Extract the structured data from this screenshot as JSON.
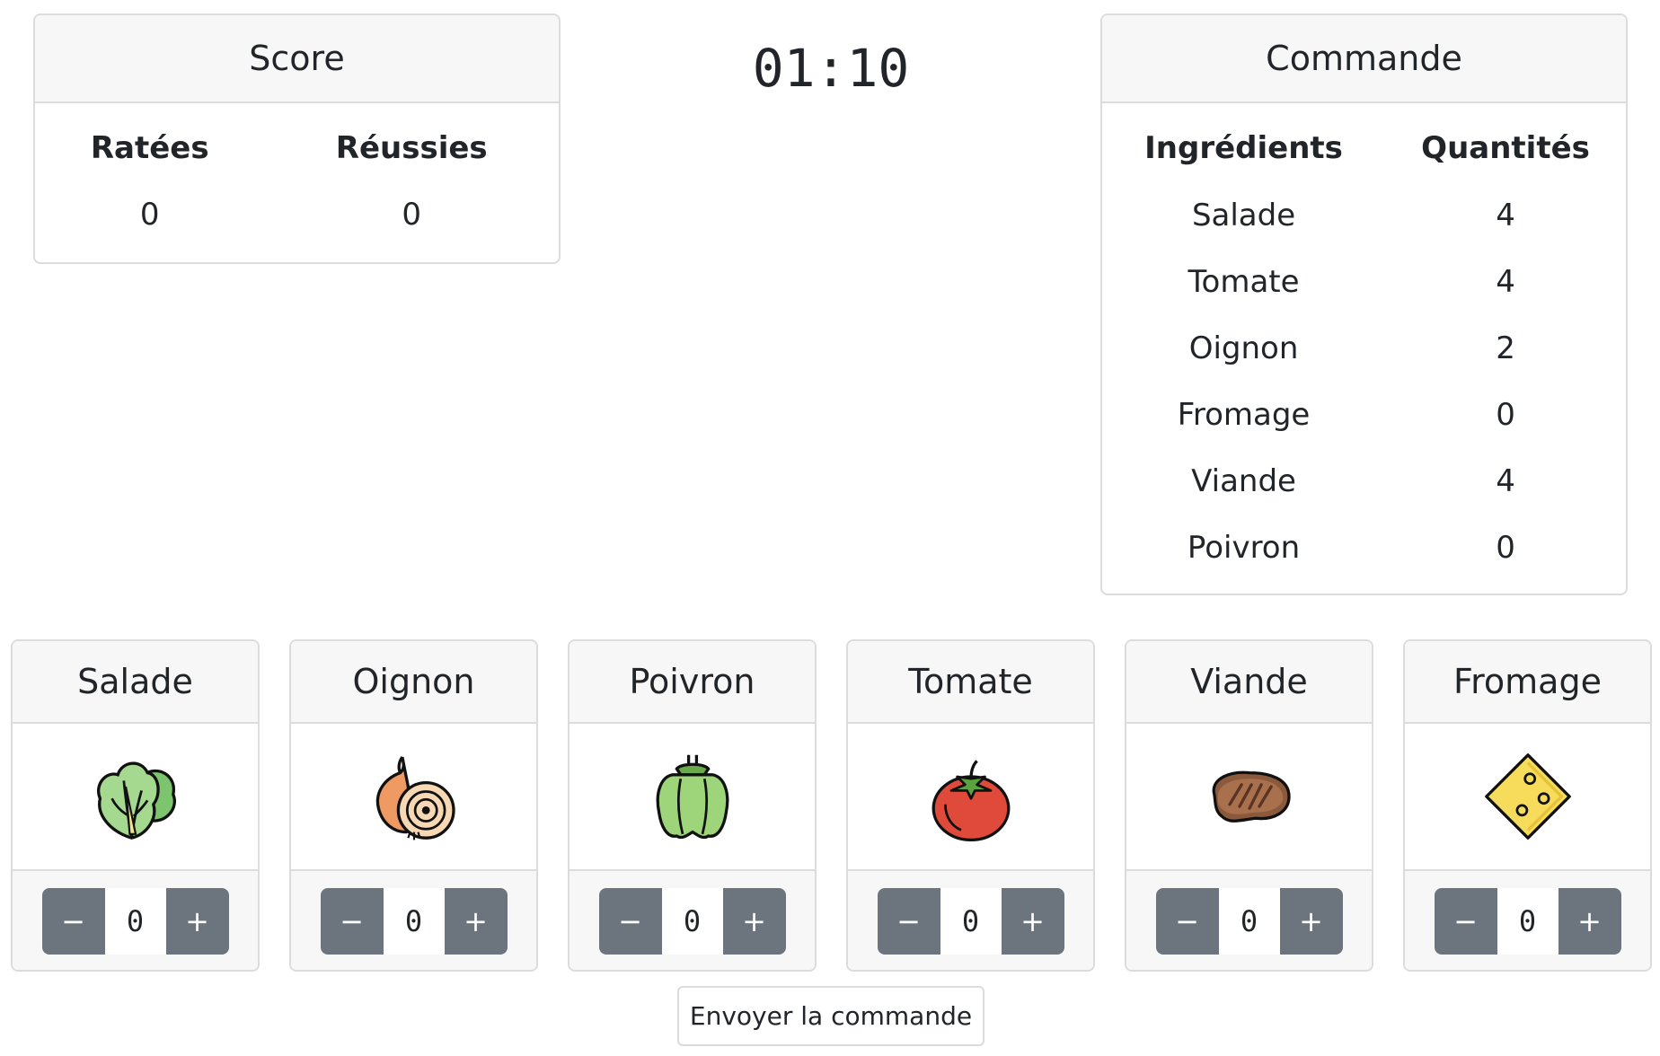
{
  "score": {
    "title": "Score",
    "columns": [
      "Ratées",
      "Réussies"
    ],
    "values": [
      "0",
      "0"
    ]
  },
  "timer": "01:10",
  "order": {
    "title": "Commande",
    "columns": [
      "Ingrédients",
      "Quantités"
    ],
    "rows": [
      {
        "ingredient": "Salade",
        "quantity": "4"
      },
      {
        "ingredient": "Tomate",
        "quantity": "4"
      },
      {
        "ingredient": "Oignon",
        "quantity": "2"
      },
      {
        "ingredient": "Fromage",
        "quantity": "0"
      },
      {
        "ingredient": "Viande",
        "quantity": "4"
      },
      {
        "ingredient": "Poivron",
        "quantity": "0"
      }
    ]
  },
  "ingredients": [
    {
      "name": "Salade",
      "icon": "lettuce-icon",
      "count": "0"
    },
    {
      "name": "Oignon",
      "icon": "onion-icon",
      "count": "0"
    },
    {
      "name": "Poivron",
      "icon": "bell-pepper-icon",
      "count": "0"
    },
    {
      "name": "Tomate",
      "icon": "tomato-icon",
      "count": "0"
    },
    {
      "name": "Viande",
      "icon": "steak-icon",
      "count": "0"
    },
    {
      "name": "Fromage",
      "icon": "cheese-icon",
      "count": "0"
    }
  ],
  "controls": {
    "minus": "−",
    "plus": "+"
  },
  "submit_label": "Envoyer la commande",
  "colors": {
    "button": "#6c757d",
    "header_bg": "#f7f7f7",
    "border": "#dcdcdc"
  }
}
